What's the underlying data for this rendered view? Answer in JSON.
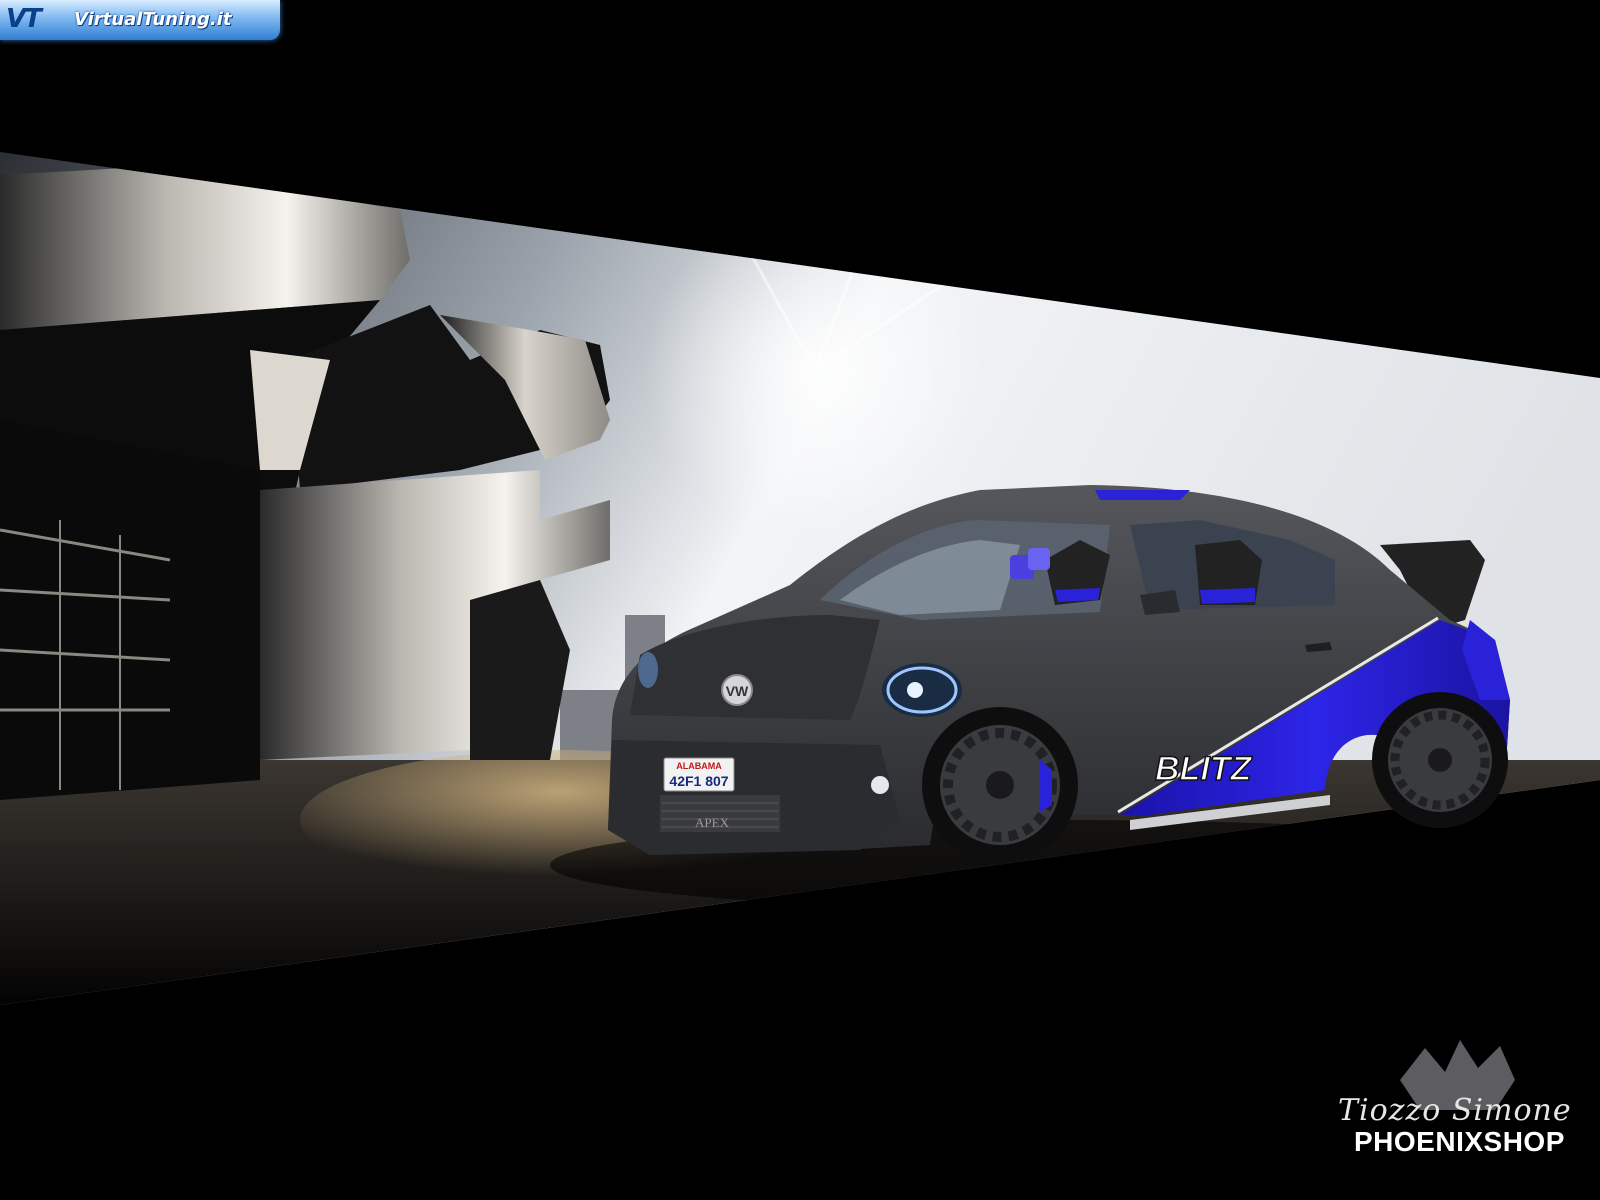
{
  "watermark": {
    "logo": "VT",
    "site": "VirtualTuning.it"
  },
  "car": {
    "plate_state": "ALABAMA",
    "plate_number": "42F1 807",
    "bumper_text": "APEX",
    "side_sponsor": "BLITZ"
  },
  "signature": {
    "author": "Tiozzo Simone",
    "shop": "PHOENIXSHOP"
  },
  "colors": {
    "accent_blue": "#2a20d8",
    "body_grey": "#3a3a3c",
    "background": "#000000"
  }
}
